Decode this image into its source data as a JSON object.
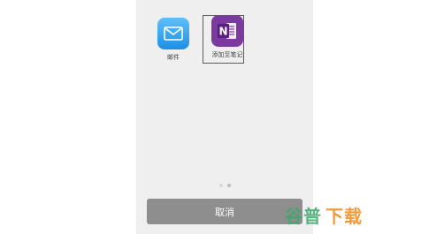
{
  "apps": [
    {
      "name": "邮件",
      "icon": "mail-icon",
      "color": "#2a9cf0"
    },
    {
      "name": "OneNote",
      "label": "添加至笔记",
      "icon": "onenote-icon",
      "color": "#7b3aa0",
      "letter": "N"
    }
  ],
  "highlight_color": "#d8262f",
  "page_indicator": {
    "pages": 2,
    "current": 2
  },
  "cancel_label": "取消",
  "watermark": {
    "part1": "谷普",
    "part2": "下载"
  }
}
